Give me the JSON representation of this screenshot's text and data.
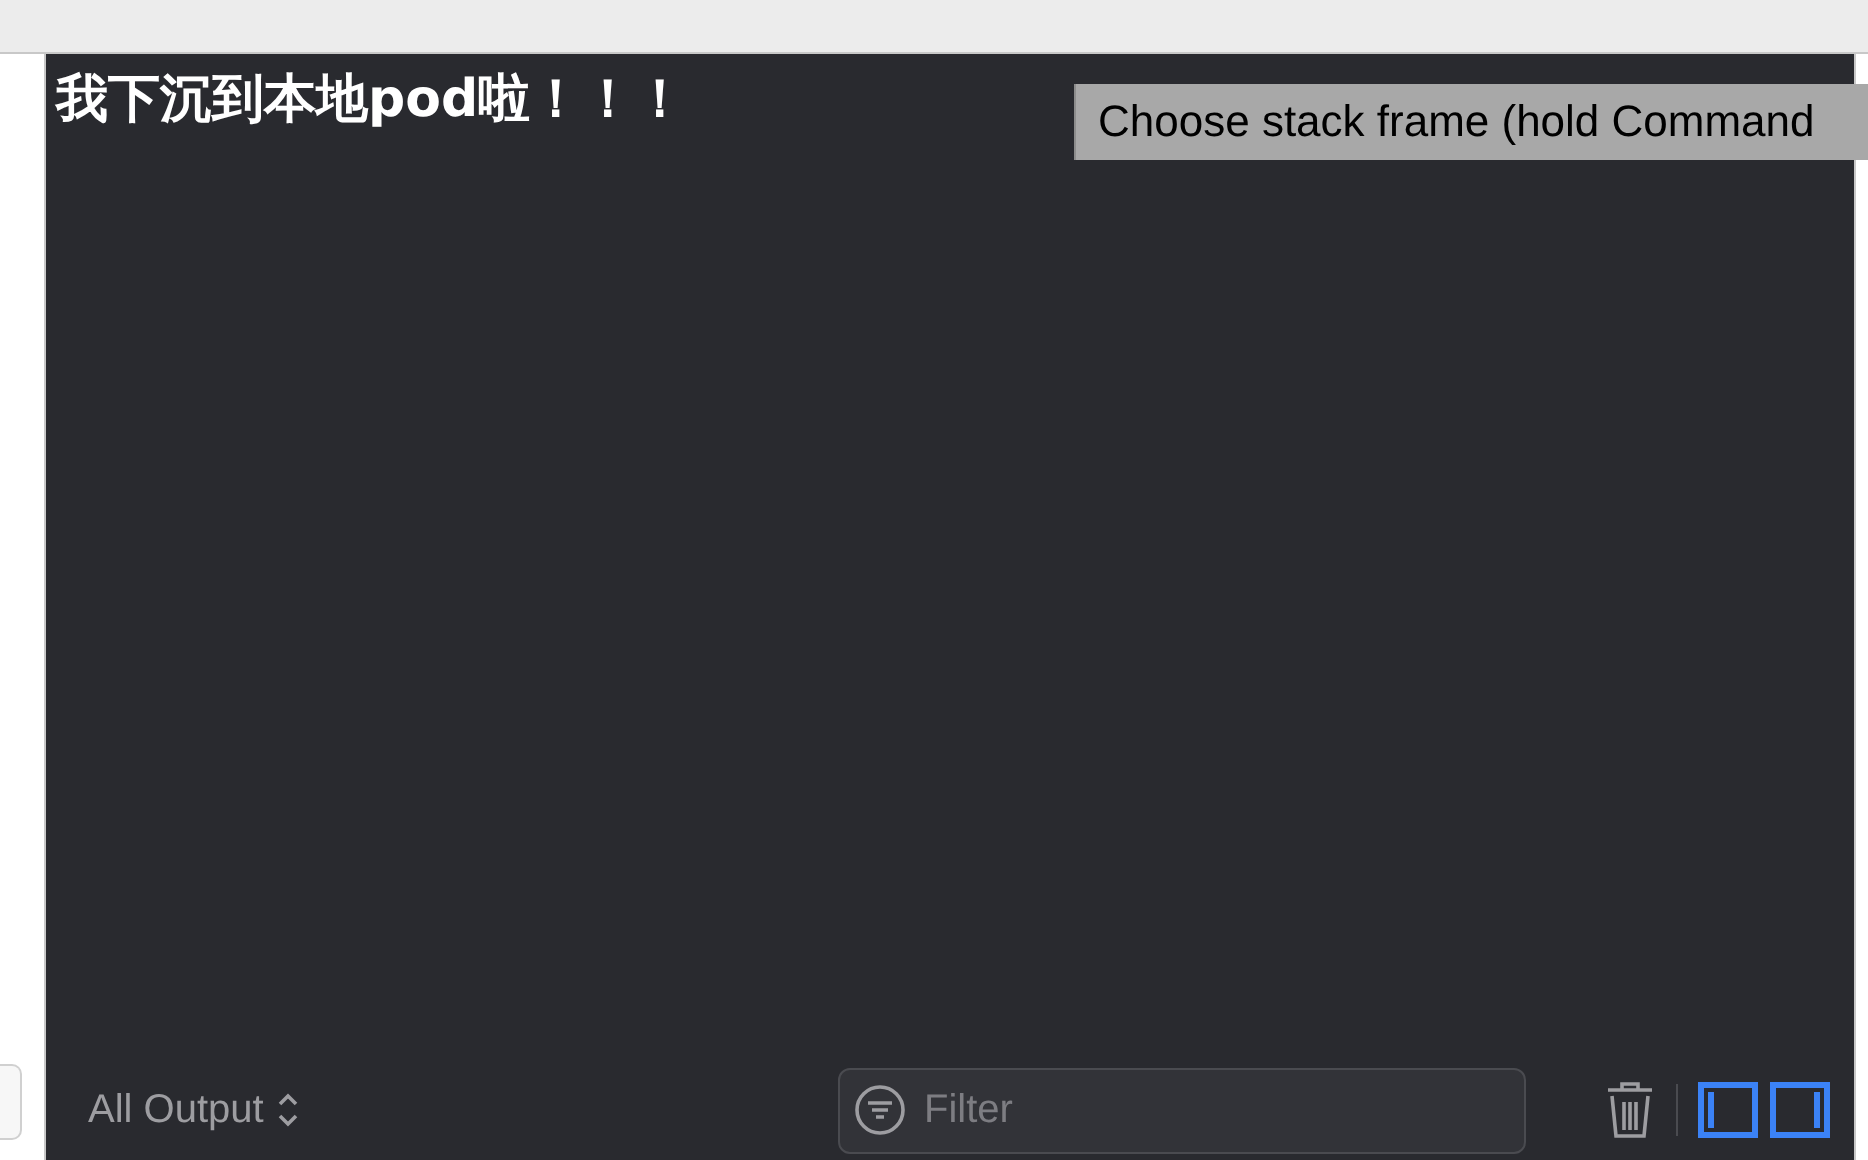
{
  "console": {
    "output": "我下沉到本地pod啦！！！"
  },
  "tooltip": {
    "text": "Choose stack frame (hold Command"
  },
  "toolbar": {
    "output_selector": "All Output",
    "filter": {
      "placeholder": "Filter"
    },
    "panes": [
      {
        "kind": "left",
        "selected": true
      },
      {
        "kind": "right",
        "selected": true
      }
    ]
  }
}
